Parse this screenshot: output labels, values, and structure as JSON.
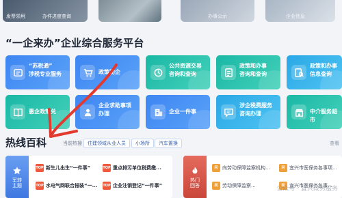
{
  "banners": [
    {
      "name": "banner-1",
      "labels": [
        "发票领用",
        "办件进度查询"
      ]
    },
    {
      "name": "banner-2",
      "labels": []
    },
    {
      "name": "banner-3",
      "labels": [
        "办事公示"
      ]
    },
    {
      "name": "banner-4",
      "labels": [
        "企业信息"
      ]
    }
  ],
  "platform_title": "“一企来办”企业综合服务平台",
  "tiles": [
    {
      "label": "“苏税通”\n涉税专业服务",
      "icon": "tax-service-icon",
      "style": ""
    },
    {
      "label": "政策助企",
      "icon": "cart-icon",
      "style": ""
    },
    {
      "label": "公共资源交易\n咨询和查询",
      "icon": "exchange-icon",
      "style": "teal"
    },
    {
      "label": "政策和办事\n咨询和查询",
      "icon": "document-icon",
      "style": "teal"
    },
    {
      "label": "政策和办事\n信息查询",
      "icon": "search-doc-icon",
      "style": "cyan"
    },
    {
      "label": "惠企政策兑",
      "icon": "policy-book-icon",
      "style": "teal"
    },
    {
      "label": "企业求助事项\n办理",
      "icon": "help-person-icon",
      "style": ""
    },
    {
      "label": "企业一件事",
      "icon": "building-icon",
      "style": ""
    },
    {
      "label": "涉企税费服务\n咨询办理",
      "icon": "tax-chat-icon",
      "style": "cyan"
    },
    {
      "label": "中介服务超市",
      "icon": "market-icon",
      "style": "teal"
    }
  ],
  "hot": {
    "title": "热线百科",
    "chips": [
      "当前热搜",
      "住建领域从业人员",
      "小场所",
      "汽车置换"
    ],
    "more": "查看",
    "left_panel": {
      "badge": "军转主题",
      "items": [
        "新生儿出生“一件事”",
        "重点排污单位税费缴...",
        "水电气网联合报装“一...",
        "企业注销登记“一件事”"
      ]
    },
    "right_panel": {
      "badge": "热门回答",
      "items": [
        "向劳动保障监察机构...",
        "宜兴市医保务各事项...",
        "劳动保障监察...",
        "宜兴市医保务各事..."
      ]
    }
  },
  "watermark": "公众号 · 宜兴政务服务",
  "colors": {
    "tile_blue": "#3e86f2",
    "tile_teal": "#1ab8a6",
    "annotation_red": "#e23a2e"
  }
}
